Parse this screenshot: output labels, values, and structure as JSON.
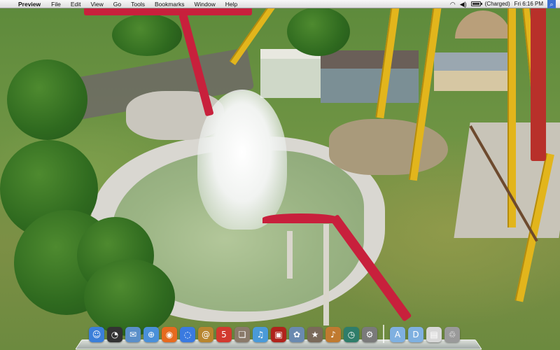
{
  "menubar": {
    "apple_glyph": "",
    "app_name": "Preview",
    "menus": [
      "File",
      "Edit",
      "View",
      "Go",
      "Tools",
      "Bookmarks",
      "Window",
      "Help"
    ],
    "status": {
      "wifi_glyph": "◠",
      "volume_glyph": "◀)",
      "battery_state": "(Charged)",
      "battery_level": 1.0,
      "clock": "Fri 6:16 PM",
      "spotlight_glyph": "⌕"
    }
  },
  "dock": {
    "items": [
      {
        "name": "finder",
        "icon": "finder-icon",
        "glyph": "☺",
        "color": "#3b7fd9"
      },
      {
        "name": "dashboard",
        "icon": "dashboard-icon",
        "glyph": "◔",
        "color": "#333333"
      },
      {
        "name": "mail",
        "icon": "mail-icon",
        "glyph": "✉",
        "color": "#5a8fc9"
      },
      {
        "name": "safari",
        "icon": "safari-icon",
        "glyph": "⊕",
        "color": "#4a90d9"
      },
      {
        "name": "firefox",
        "icon": "firefox-icon",
        "glyph": "◉",
        "color": "#e66a1f"
      },
      {
        "name": "ichat",
        "icon": "ichat-icon",
        "glyph": "◌",
        "color": "#3a7ae0"
      },
      {
        "name": "address-book",
        "icon": "address-book-icon",
        "glyph": "@",
        "color": "#b8862f"
      },
      {
        "name": "ical",
        "icon": "ical-icon",
        "glyph": "5",
        "color": "#d23a2f"
      },
      {
        "name": "preview",
        "icon": "preview-icon",
        "glyph": "❏",
        "color": "#8a7a6a"
      },
      {
        "name": "itunes",
        "icon": "itunes-icon",
        "glyph": "♫",
        "color": "#4a9ad8"
      },
      {
        "name": "photo-booth",
        "icon": "photo-booth-icon",
        "glyph": "▣",
        "color": "#b0241c"
      },
      {
        "name": "iphoto",
        "icon": "iphoto-icon",
        "glyph": "✿",
        "color": "#6a8ab0"
      },
      {
        "name": "imovie",
        "icon": "imovie-icon",
        "glyph": "★",
        "color": "#7a6a5a"
      },
      {
        "name": "garageband",
        "icon": "garageband-icon",
        "glyph": "♪",
        "color": "#c07a30"
      },
      {
        "name": "time-machine",
        "icon": "time-machine-icon",
        "glyph": "◷",
        "color": "#2f7d6a"
      },
      {
        "name": "system-preferences",
        "icon": "gear-icon",
        "glyph": "⚙",
        "color": "#7a7a7a"
      }
    ],
    "right_items": [
      {
        "name": "applications-folder",
        "icon": "folder-icon",
        "glyph": "A",
        "color": "#7fb0e0"
      },
      {
        "name": "documents-folder",
        "icon": "folder-icon",
        "glyph": "D",
        "color": "#7fb0e0"
      },
      {
        "name": "downloads-stack",
        "icon": "document-icon",
        "glyph": "▤",
        "color": "#d8d8d8"
      },
      {
        "name": "trash",
        "icon": "trash-icon",
        "glyph": "♲",
        "color": "#9a9a9a"
      }
    ]
  }
}
